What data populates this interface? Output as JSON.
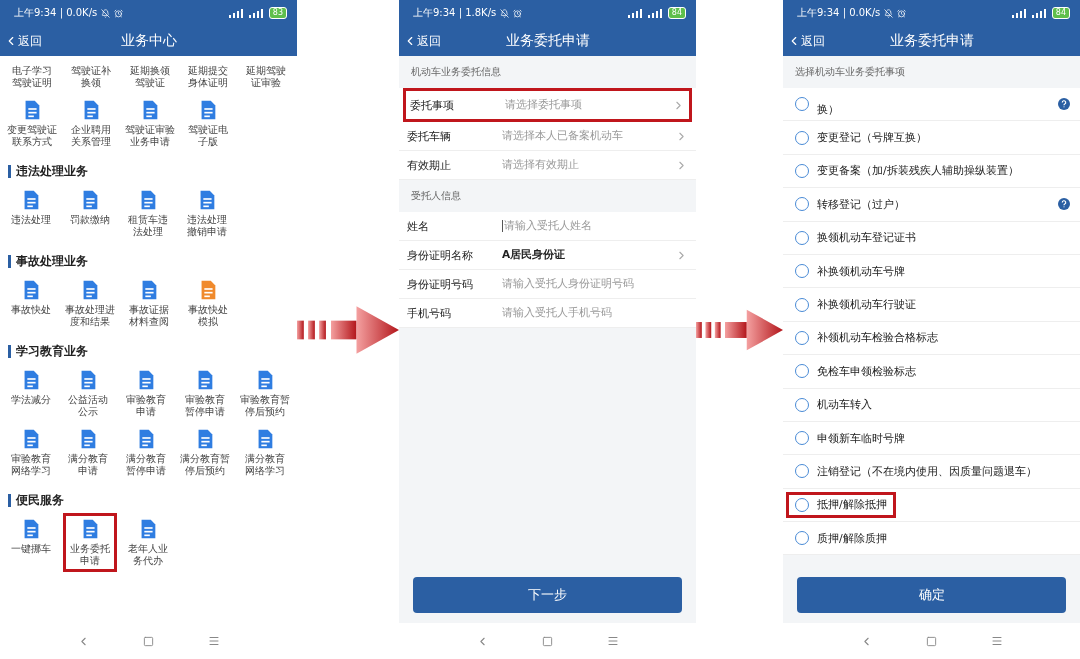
{
  "phones": [
    {
      "kind": "service_grid",
      "status": {
        "text": "上午9:34 | 0.0K/s",
        "battery": "83"
      },
      "header": {
        "back": "返回",
        "title": "业务中心"
      },
      "groups": [
        {
          "items": [
            {
              "lines": [
                "电子学习",
                "驾驶证明"
              ],
              "cut_off": true,
              "highlighted": false
            },
            {
              "lines": [
                "驾驶证补",
                "换领"
              ],
              "cut_off": true,
              "highlighted": false
            },
            {
              "lines": [
                "延期换领",
                "驾驶证"
              ],
              "cut_off": true,
              "highlighted": false
            },
            {
              "lines": [
                "延期提交",
                "身体证明"
              ],
              "cut_off": true,
              "highlighted": false
            },
            {
              "lines": [
                "延期驾驶",
                "证审验"
              ],
              "cut_off": true,
              "highlighted": false
            },
            {
              "lines": [
                "变更驾驶证",
                "联系方式"
              ],
              "cut_off": false,
              "highlighted": false,
              "color": "#2f7de1"
            },
            {
              "lines": [
                "企业聘用",
                "关系管理"
              ],
              "cut_off": false,
              "highlighted": false,
              "color": "#2f7de1"
            },
            {
              "lines": [
                "驾驶证审验",
                "业务申请"
              ],
              "cut_off": false,
              "highlighted": false,
              "color": "#2f7de1"
            },
            {
              "lines": [
                "驾驶证电",
                "子版"
              ],
              "cut_off": false,
              "highlighted": false,
              "color": "#2f7de1"
            }
          ]
        },
        {
          "title": "违法处理业务",
          "items": [
            {
              "lines": [
                "违法处理"
              ],
              "cut_off": false,
              "highlighted": false,
              "color": "#2f7de1"
            },
            {
              "lines": [
                "罚款缴纳"
              ],
              "cut_off": false,
              "highlighted": false,
              "color": "#2f7de1"
            },
            {
              "lines": [
                "租赁车违",
                "法处理"
              ],
              "cut_off": false,
              "highlighted": false,
              "color": "#2f7de1"
            },
            {
              "lines": [
                "违法处理",
                "撤销申请"
              ],
              "cut_off": false,
              "highlighted": false,
              "color": "#2f7de1"
            }
          ]
        },
        {
          "title": "事故处理业务",
          "items": [
            {
              "lines": [
                "事故快处"
              ],
              "cut_off": false,
              "highlighted": false,
              "color": "#2f7de1"
            },
            {
              "lines": [
                "事故处理进",
                "度和结果"
              ],
              "cut_off": false,
              "highlighted": false,
              "color": "#2f7de1"
            },
            {
              "lines": [
                "事故证据",
                "材料查阅"
              ],
              "cut_off": false,
              "highlighted": false,
              "color": "#2f7de1"
            },
            {
              "lines": [
                "事故快处",
                "模拟"
              ],
              "cut_off": false,
              "highlighted": false,
              "color": "#f08a2c"
            }
          ]
        },
        {
          "title": "学习教育业务",
          "items": [
            {
              "lines": [
                "学法减分"
              ],
              "cut_off": false,
              "highlighted": false,
              "color": "#2f7de1"
            },
            {
              "lines": [
                "公益活动",
                "公示"
              ],
              "cut_off": false,
              "highlighted": false,
              "color": "#2f7de1"
            },
            {
              "lines": [
                "审验教育",
                "申请"
              ],
              "cut_off": false,
              "highlighted": false,
              "color": "#2f7de1"
            },
            {
              "lines": [
                "审验教育",
                "暂停申请"
              ],
              "cut_off": false,
              "highlighted": false,
              "color": "#2f7de1"
            },
            {
              "lines": [
                "审验教育暂",
                "停后预约"
              ],
              "cut_off": false,
              "highlighted": false,
              "color": "#2f7de1"
            },
            {
              "lines": [
                "审验教育",
                "网络学习"
              ],
              "cut_off": false,
              "highlighted": false,
              "color": "#2f7de1"
            },
            {
              "lines": [
                "满分教育",
                "申请"
              ],
              "cut_off": false,
              "highlighted": false,
              "color": "#2f7de1"
            },
            {
              "lines": [
                "满分教育",
                "暂停申请"
              ],
              "cut_off": false,
              "highlighted": false,
              "color": "#2f7de1"
            },
            {
              "lines": [
                "满分教育暂",
                "停后预约"
              ],
              "cut_off": false,
              "highlighted": false,
              "color": "#2f7de1"
            },
            {
              "lines": [
                "满分教育",
                "网络学习"
              ],
              "cut_off": false,
              "highlighted": false,
              "color": "#2f7de1"
            }
          ]
        },
        {
          "title": "便民服务",
          "items": [
            {
              "lines": [
                "一键挪车"
              ],
              "cut_off": false,
              "highlighted": false,
              "color": "#2f7de1"
            },
            {
              "lines": [
                "业务委托",
                "申请"
              ],
              "cut_off": false,
              "highlighted": true,
              "color": "#2f7de1"
            },
            {
              "lines": [
                "老年人业",
                "务代办"
              ],
              "cut_off": false,
              "highlighted": false,
              "color": "#2f7de1"
            }
          ]
        }
      ]
    },
    {
      "kind": "form",
      "status": {
        "text": "上午9:34 | 1.8K/s",
        "battery": "84"
      },
      "header": {
        "back": "返回",
        "title": "业务委托申请"
      },
      "sections": [
        {
          "title": "机动车业务委托信息",
          "rows": [
            {
              "kind": "select",
              "label": "委托事项",
              "placeholder": "请选择委托事项",
              "highlighted": true
            },
            {
              "kind": "select",
              "label": "委托车辆",
              "placeholder": "请选择本人已备案机动车",
              "highlighted": false
            },
            {
              "kind": "select",
              "label": "有效期止",
              "placeholder": "请选择有效期止",
              "highlighted": false
            }
          ]
        },
        {
          "title": "受托人信息",
          "rows": [
            {
              "kind": "input",
              "label": "姓名",
              "placeholder": "请输入受托人姓名",
              "highlighted": false
            },
            {
              "kind": "select",
              "label": "身份证明名称",
              "value": "A居民身份证",
              "highlighted": false
            },
            {
              "kind": "input",
              "label": "身份证明号码",
              "placeholder": "请输入受托人身份证明号码",
              "highlighted": false
            },
            {
              "kind": "input",
              "label": "手机号码",
              "placeholder": "请输入受托人手机号码",
              "highlighted": false
            }
          ]
        }
      ],
      "button": "下一步"
    },
    {
      "kind": "option_list",
      "status": {
        "text": "上午9:34 | 0.0K/s",
        "battery": "84"
      },
      "header": {
        "back": "返回",
        "title": "业务委托申请"
      },
      "title": "选择机动车业务委托事项",
      "options": [
        {
          "label": "换）",
          "selected": false,
          "help": true,
          "highlighted": false,
          "cut_off": true
        },
        {
          "label": "变更登记（号牌互换）",
          "selected": false,
          "help": false,
          "highlighted": false,
          "cut_off": false
        },
        {
          "label": "变更备案（加/拆装残疾人辅助操纵装置）",
          "selected": false,
          "help": false,
          "highlighted": false,
          "cut_off": false
        },
        {
          "label": "转移登记（过户）",
          "selected": false,
          "help": true,
          "highlighted": false,
          "cut_off": false
        },
        {
          "label": "换领机动车登记证书",
          "selected": false,
          "help": false,
          "highlighted": false,
          "cut_off": false
        },
        {
          "label": "补换领机动车号牌",
          "selected": false,
          "help": false,
          "highlighted": false,
          "cut_off": false
        },
        {
          "label": "补换领机动车行驶证",
          "selected": false,
          "help": false,
          "highlighted": false,
          "cut_off": false
        },
        {
          "label": "补领机动车检验合格标志",
          "selected": false,
          "help": false,
          "highlighted": false,
          "cut_off": false
        },
        {
          "label": "免检车申领检验标志",
          "selected": false,
          "help": false,
          "highlighted": false,
          "cut_off": false
        },
        {
          "label": "机动车转入",
          "selected": false,
          "help": false,
          "highlighted": false,
          "cut_off": false
        },
        {
          "label": "申领新车临时号牌",
          "selected": false,
          "help": false,
          "highlighted": false,
          "cut_off": false
        },
        {
          "label": "注销登记（不在境内使用、因质量问题退车）",
          "selected": false,
          "help": false,
          "highlighted": false,
          "cut_off": false
        },
        {
          "label": "抵押/解除抵押",
          "selected": false,
          "help": false,
          "highlighted": true,
          "cut_off": false
        },
        {
          "label": "质押/解除质押",
          "selected": false,
          "help": false,
          "highlighted": false,
          "cut_off": false
        }
      ],
      "button": "确定"
    }
  ]
}
